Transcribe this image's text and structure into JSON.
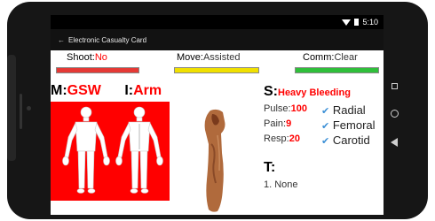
{
  "status_bar": {
    "time": "5:10"
  },
  "app_bar": {
    "title": "Electronic Casualty Card"
  },
  "fields": {
    "shoot": {
      "label": "Shoot:",
      "value": "No",
      "bar_color": "#e53935"
    },
    "move": {
      "label": "Move:",
      "value": "Assisted",
      "bar_color": "#f0e000"
    },
    "comm": {
      "label": "Comm:",
      "value": "Clear",
      "bar_color": "#2fbf3a"
    }
  },
  "mechanism": {
    "label": "M:",
    "value": "GSW"
  },
  "injury": {
    "label": "I:",
    "value": "Arm"
  },
  "symptoms": {
    "label": "S:",
    "value": "Heavy Bleeding"
  },
  "vitals": [
    {
      "label": "Pulse:",
      "value": "100"
    },
    {
      "label": "Pain:",
      "value": "9"
    },
    {
      "label": "Resp:",
      "value": "20"
    }
  ],
  "checks": [
    {
      "label": "Radial",
      "icon": "check-icon"
    },
    {
      "label": "Femoral",
      "icon": "check-icon"
    },
    {
      "label": "Carotid",
      "icon": "check-icon"
    }
  ],
  "treatment": {
    "label": "T:",
    "items": [
      "1. None"
    ]
  },
  "colors": {
    "accent_red": "#ff0000",
    "check_blue": "#3b8fd6"
  }
}
